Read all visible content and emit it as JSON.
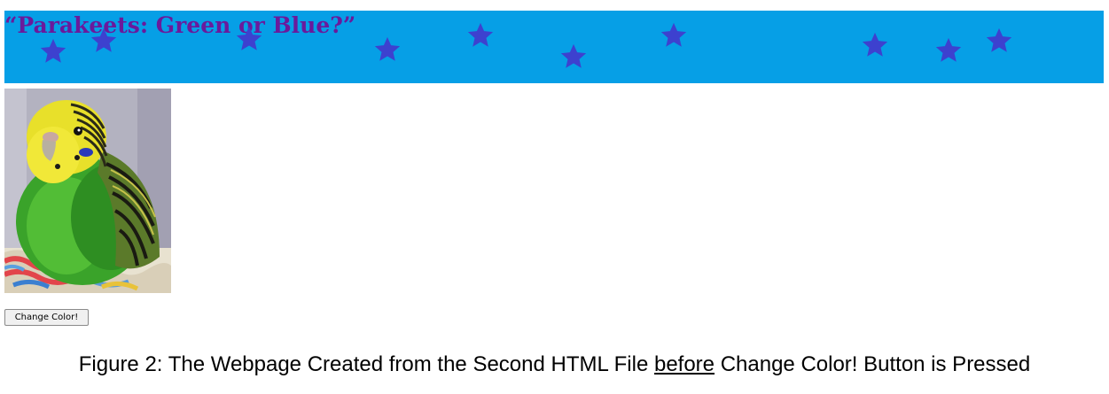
{
  "banner": {
    "title": "“Parakeets: Green or Blue?”",
    "background": "#069fe6",
    "title_color": "#6a1a9c",
    "star_color": "#3d41cf",
    "star_icon": "star-icon"
  },
  "image": {
    "alt": "Green parakeet"
  },
  "button": {
    "label": "Change Color!"
  },
  "caption": {
    "prefix": "Figure 2: The Webpage Created from the Second HTML File ",
    "emphasis": "before",
    "suffix": " Change Color! Button is Pressed"
  }
}
